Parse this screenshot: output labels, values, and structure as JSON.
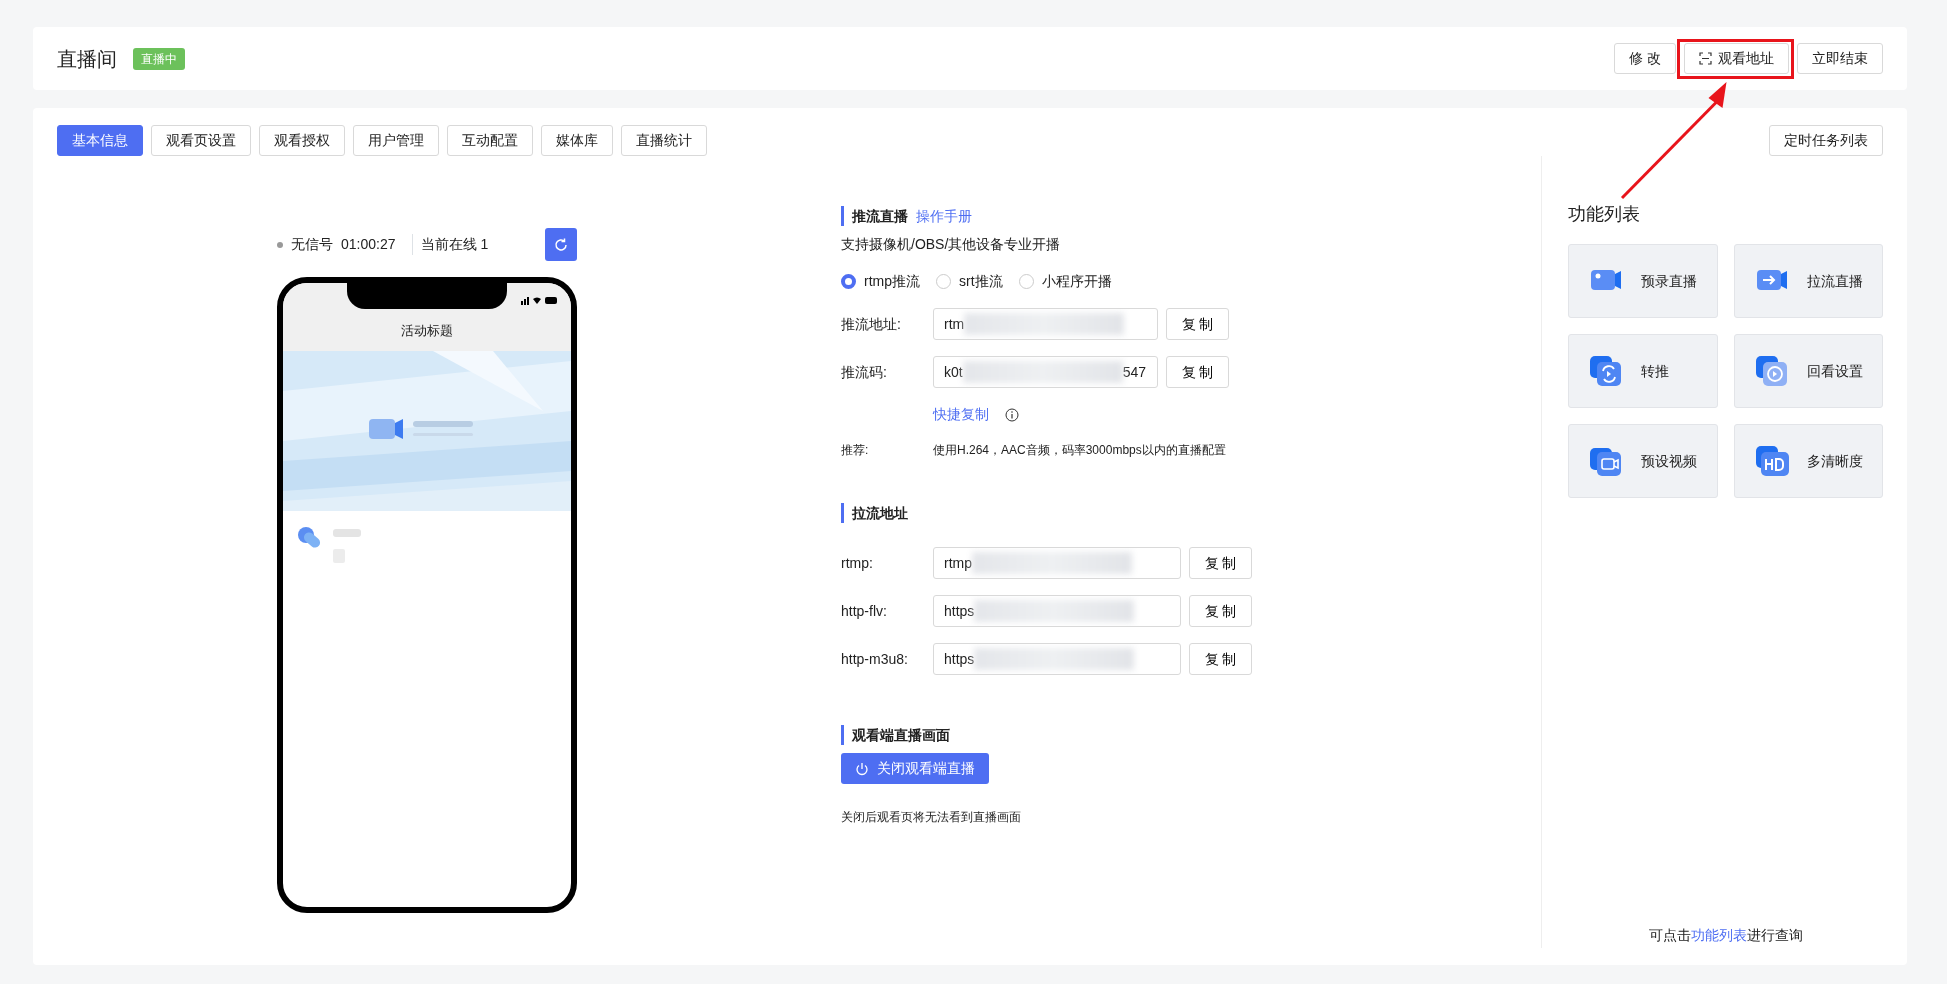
{
  "header": {
    "title": "直播间",
    "badge": "直播中",
    "buttons": [
      {
        "label": "修 改",
        "kind": "plain",
        "highlighted": false
      },
      {
        "label": "观看地址",
        "kind": "scan",
        "highlighted": true
      },
      {
        "label": "立即结束",
        "kind": "plain",
        "highlighted": false
      }
    ]
  },
  "tabs": [
    {
      "label": "基本信息",
      "selected": true
    },
    {
      "label": "观看页设置",
      "selected": false
    },
    {
      "label": "观看授权",
      "selected": false
    },
    {
      "label": "用户管理",
      "selected": false
    },
    {
      "label": "互动配置",
      "selected": false
    },
    {
      "label": "媒体库",
      "selected": false
    },
    {
      "label": "直播统计",
      "selected": false
    }
  ],
  "schedule_button": "定时任务列表",
  "preview": {
    "signal": "无信号",
    "duration": "01:00:27",
    "online": "当前在线 1",
    "phone_title": "活动标题"
  },
  "push": {
    "title": "推流直播",
    "manual_link": "操作手册",
    "description": "支持摄像机/OBS/其他设备专业开播",
    "modes": [
      {
        "label": "rtmp推流",
        "selected": true
      },
      {
        "label": "srt推流",
        "selected": false
      },
      {
        "label": "小程序开播",
        "selected": false
      }
    ],
    "fields": [
      {
        "label": "推流地址:",
        "value": "rtm",
        "button": "复 制"
      },
      {
        "label": "推流码:",
        "value": "k0t",
        "tail": "547",
        "button": "复 制"
      }
    ],
    "quick_copy": "快捷复制",
    "recommend_label": "推荐:",
    "recommend_text": "使用H.264，AAC音频，码率3000mbps以内的直播配置"
  },
  "pull": {
    "title": "拉流地址",
    "fields": [
      {
        "label": "rtmp:",
        "value": "rtmp",
        "button": "复 制"
      },
      {
        "label": "http-flv:",
        "value": "https",
        "button": "复 制"
      },
      {
        "label": "http-m3u8:",
        "value": "https",
        "button": "复 制"
      }
    ]
  },
  "viewer": {
    "title": "观看端直播画面",
    "button": "关闭观看端直播",
    "note": "关闭后观看页将无法看到直播画面"
  },
  "features": {
    "title": "功能列表",
    "items": [
      {
        "label": "预录直播",
        "kind": "record"
      },
      {
        "label": "拉流直播",
        "kind": "pull"
      },
      {
        "label": "转推",
        "kind": "relay"
      },
      {
        "label": "回看设置",
        "kind": "replay"
      },
      {
        "label": "预设视频",
        "kind": "video"
      },
      {
        "label": "多清晰度",
        "kind": "hd"
      }
    ],
    "footer_prefix": "可点击",
    "footer_link": "功能列表",
    "footer_suffix": "进行查询"
  }
}
